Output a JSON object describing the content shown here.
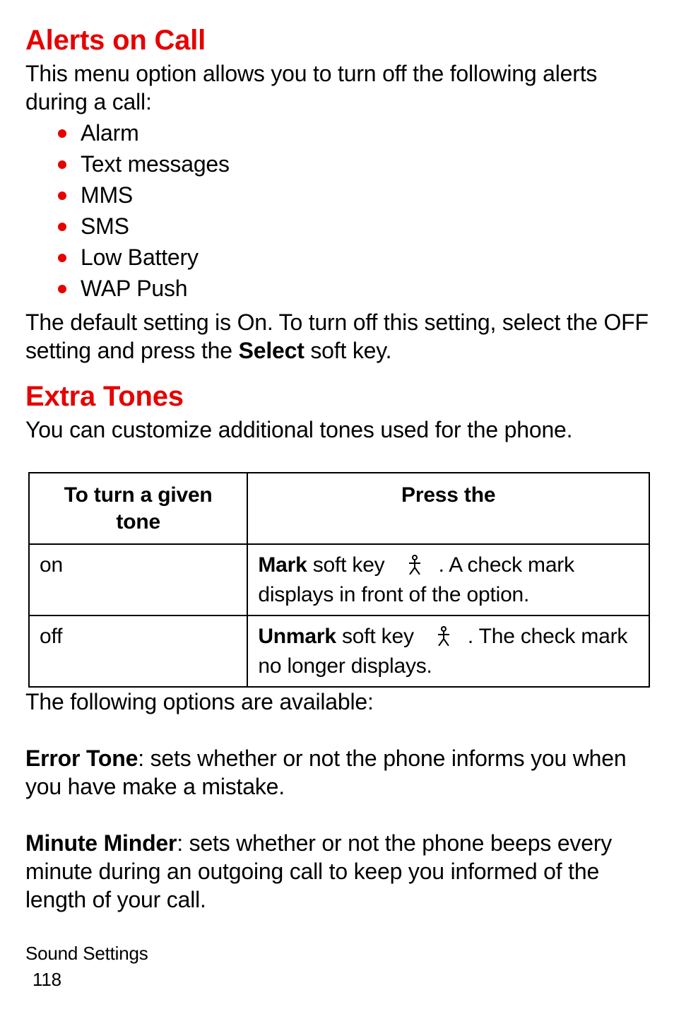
{
  "section1": {
    "heading": "Alerts on Call",
    "intro": "This menu option allows you to turn off the following alerts during a call:",
    "bullets": [
      "Alarm",
      "Text messages",
      "MMS",
      "SMS",
      "Low Battery",
      "WAP Push"
    ],
    "closing_pre": "The default setting is On. To turn off this setting, select the OFF setting and press the ",
    "closing_bold": "Select",
    "closing_post": " soft key."
  },
  "section2": {
    "heading": "Extra Tones",
    "intro": "You can customize additional tones used for the phone."
  },
  "table": {
    "header_left": "To turn a given tone",
    "header_right": "Press the",
    "rows": [
      {
        "left": "on",
        "right_bold": "Mark",
        "right_mid1": " soft key ",
        "icon": "person-icon",
        "right_mid2": ". A check mark displays in front of the option."
      },
      {
        "left": "off",
        "right_bold": "Unmark",
        "right_mid1": " soft key ",
        "icon": "person-icon",
        "right_mid2": ". The check mark no longer displays."
      }
    ]
  },
  "options": {
    "intro": "The following options are available:",
    "items": [
      {
        "bold": "Error Tone",
        "rest": ": sets whether or not the phone informs you when you have make a mistake."
      },
      {
        "bold": "Minute Minder",
        "rest": ": sets whether or not the phone beeps every minute during an outgoing call to keep you informed of the length of your call."
      }
    ]
  },
  "footer": {
    "section_title": "Sound Settings",
    "page_number": "118"
  }
}
